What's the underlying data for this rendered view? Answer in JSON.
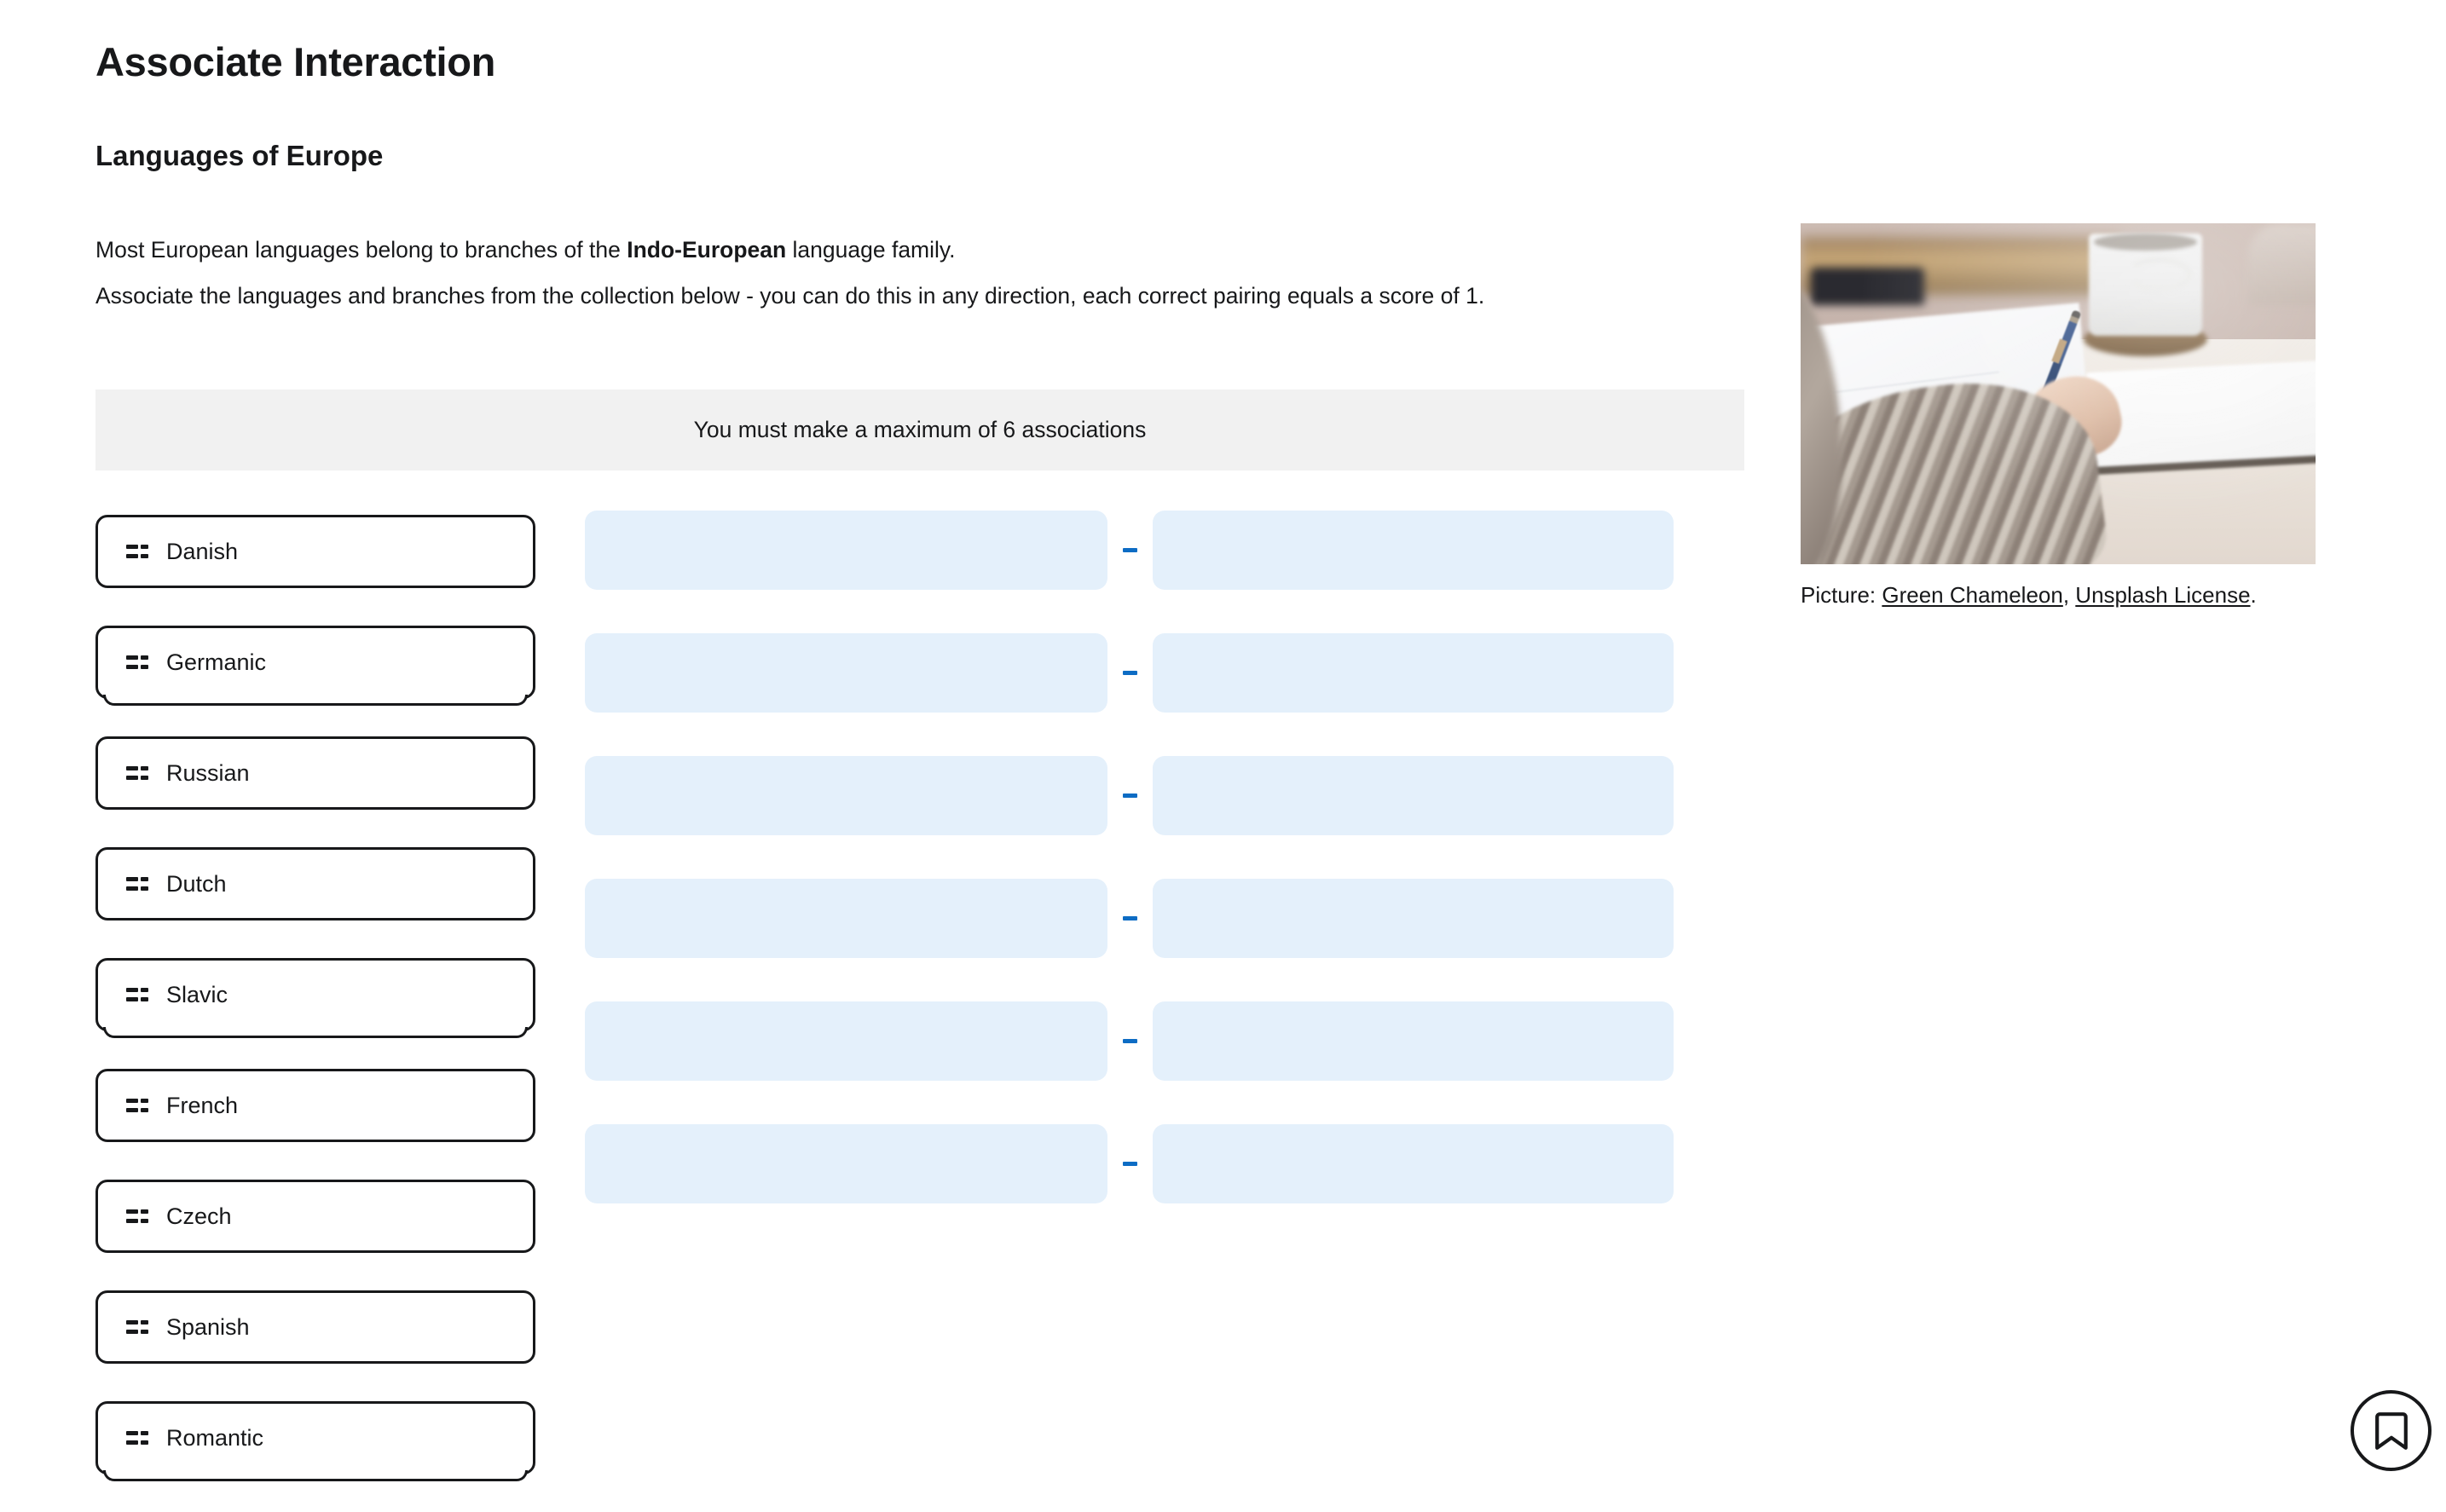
{
  "page": {
    "title": "Associate Interaction",
    "section_title": "Languages of Europe"
  },
  "intro": {
    "line1_before": "Most European languages belong to branches of the ",
    "line1_bold": "Indo-European",
    "line1_after": " language family.",
    "line2": "Associate the languages and branches from the collection below - you can do this in any direction, each correct pairing equals a score of 1."
  },
  "notice": {
    "text": "You must make a maximum of 6 associations"
  },
  "choices": {
    "handle_icon": "drag-handle-icon",
    "items": [
      {
        "label": "Danish",
        "stacked": false
      },
      {
        "label": "Germanic",
        "stacked": true
      },
      {
        "label": "Russian",
        "stacked": false
      },
      {
        "label": "Dutch",
        "stacked": false
      },
      {
        "label": "Slavic",
        "stacked": true
      },
      {
        "label": "French",
        "stacked": false
      },
      {
        "label": "Czech",
        "stacked": false
      },
      {
        "label": "Spanish",
        "stacked": false
      },
      {
        "label": "Romantic",
        "stacked": true
      }
    ]
  },
  "associations": {
    "separator": "–",
    "rows": [
      {
        "left": "",
        "right": ""
      },
      {
        "left": "",
        "right": ""
      },
      {
        "left": "",
        "right": ""
      },
      {
        "left": "",
        "right": ""
      },
      {
        "left": "",
        "right": ""
      },
      {
        "left": "",
        "right": ""
      }
    ]
  },
  "figure": {
    "image_alt": "Person writing with a pen on papers at a wooden desk beside a white coffee mug",
    "caption_prefix": "Picture: ",
    "caption_link1": "Green Chameleon",
    "caption_separator": ", ",
    "caption_link2": "Unsplash License",
    "caption_suffix": "."
  },
  "bookmark": {
    "icon": "bookmark-icon",
    "label": "Bookmark"
  },
  "colors": {
    "dropzone_fill": "#e4f0fb",
    "separator_blue": "#0d6cc4",
    "notice_bg": "#f1f1f1",
    "text": "#17181a"
  }
}
